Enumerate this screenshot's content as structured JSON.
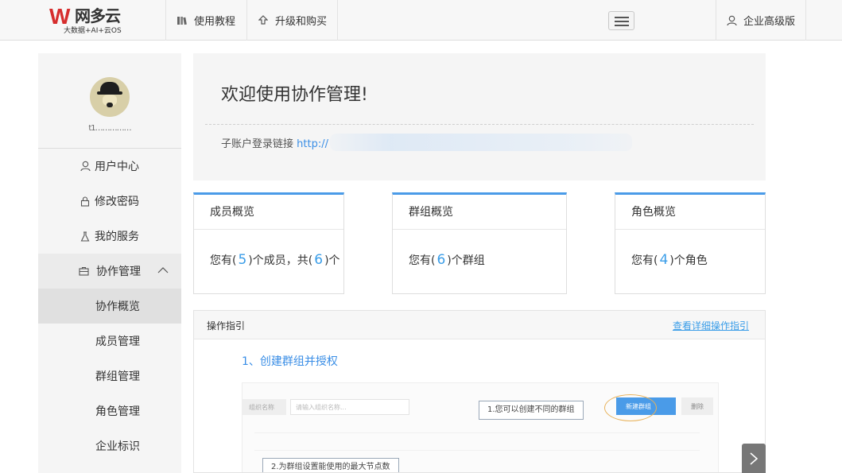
{
  "topbar": {
    "logo_mark": "W",
    "logo_name": "网多云",
    "logo_sub": "大数据+AI+云OS",
    "tutorial_label": "使用教程",
    "upgrade_label": "升级和购买",
    "edition_label": "企业高级版"
  },
  "sidebar": {
    "username": "t1……………",
    "items": [
      {
        "label": "用户中心",
        "icon": "user-icon"
      },
      {
        "label": "修改密码",
        "icon": "lock-icon"
      },
      {
        "label": "我的服务",
        "icon": "flask-icon"
      },
      {
        "label": "协作管理",
        "icon": "briefcase-icon",
        "expanded": true
      },
      {
        "label": "协作概览",
        "active": true
      },
      {
        "label": "成员管理"
      },
      {
        "label": "群组管理"
      },
      {
        "label": "角色管理"
      },
      {
        "label": "企业标识"
      }
    ]
  },
  "welcome": {
    "title": "欢迎使用协作管理!",
    "login_label": "子账户登录链接",
    "login_url": "http://"
  },
  "cards": [
    {
      "title": "成员概览",
      "prefix": "您有(",
      "num1": "5",
      "mid": ")个成员，共(",
      "num2": "6",
      "suffix": ")个"
    },
    {
      "title": "群组概览",
      "prefix": "您有(",
      "num1": "6",
      "suffix": ")个群组"
    },
    {
      "title": "角色概览",
      "prefix": "您有(",
      "num1": "4",
      "suffix": ")个角色"
    }
  ],
  "guide": {
    "title": "操作指引",
    "detail_link": "查看详细操作指引",
    "step1_title": "1、创建群组并授权",
    "shot": {
      "search_label": "组织名称",
      "search_placeholder": "请输入组织名称...",
      "new_group_btn": "新建群组",
      "delete_btn": "删除",
      "callout1": "1.您可以创建不同的群组",
      "callout2": "2.为群组设置能使用的最大节点数"
    }
  }
}
